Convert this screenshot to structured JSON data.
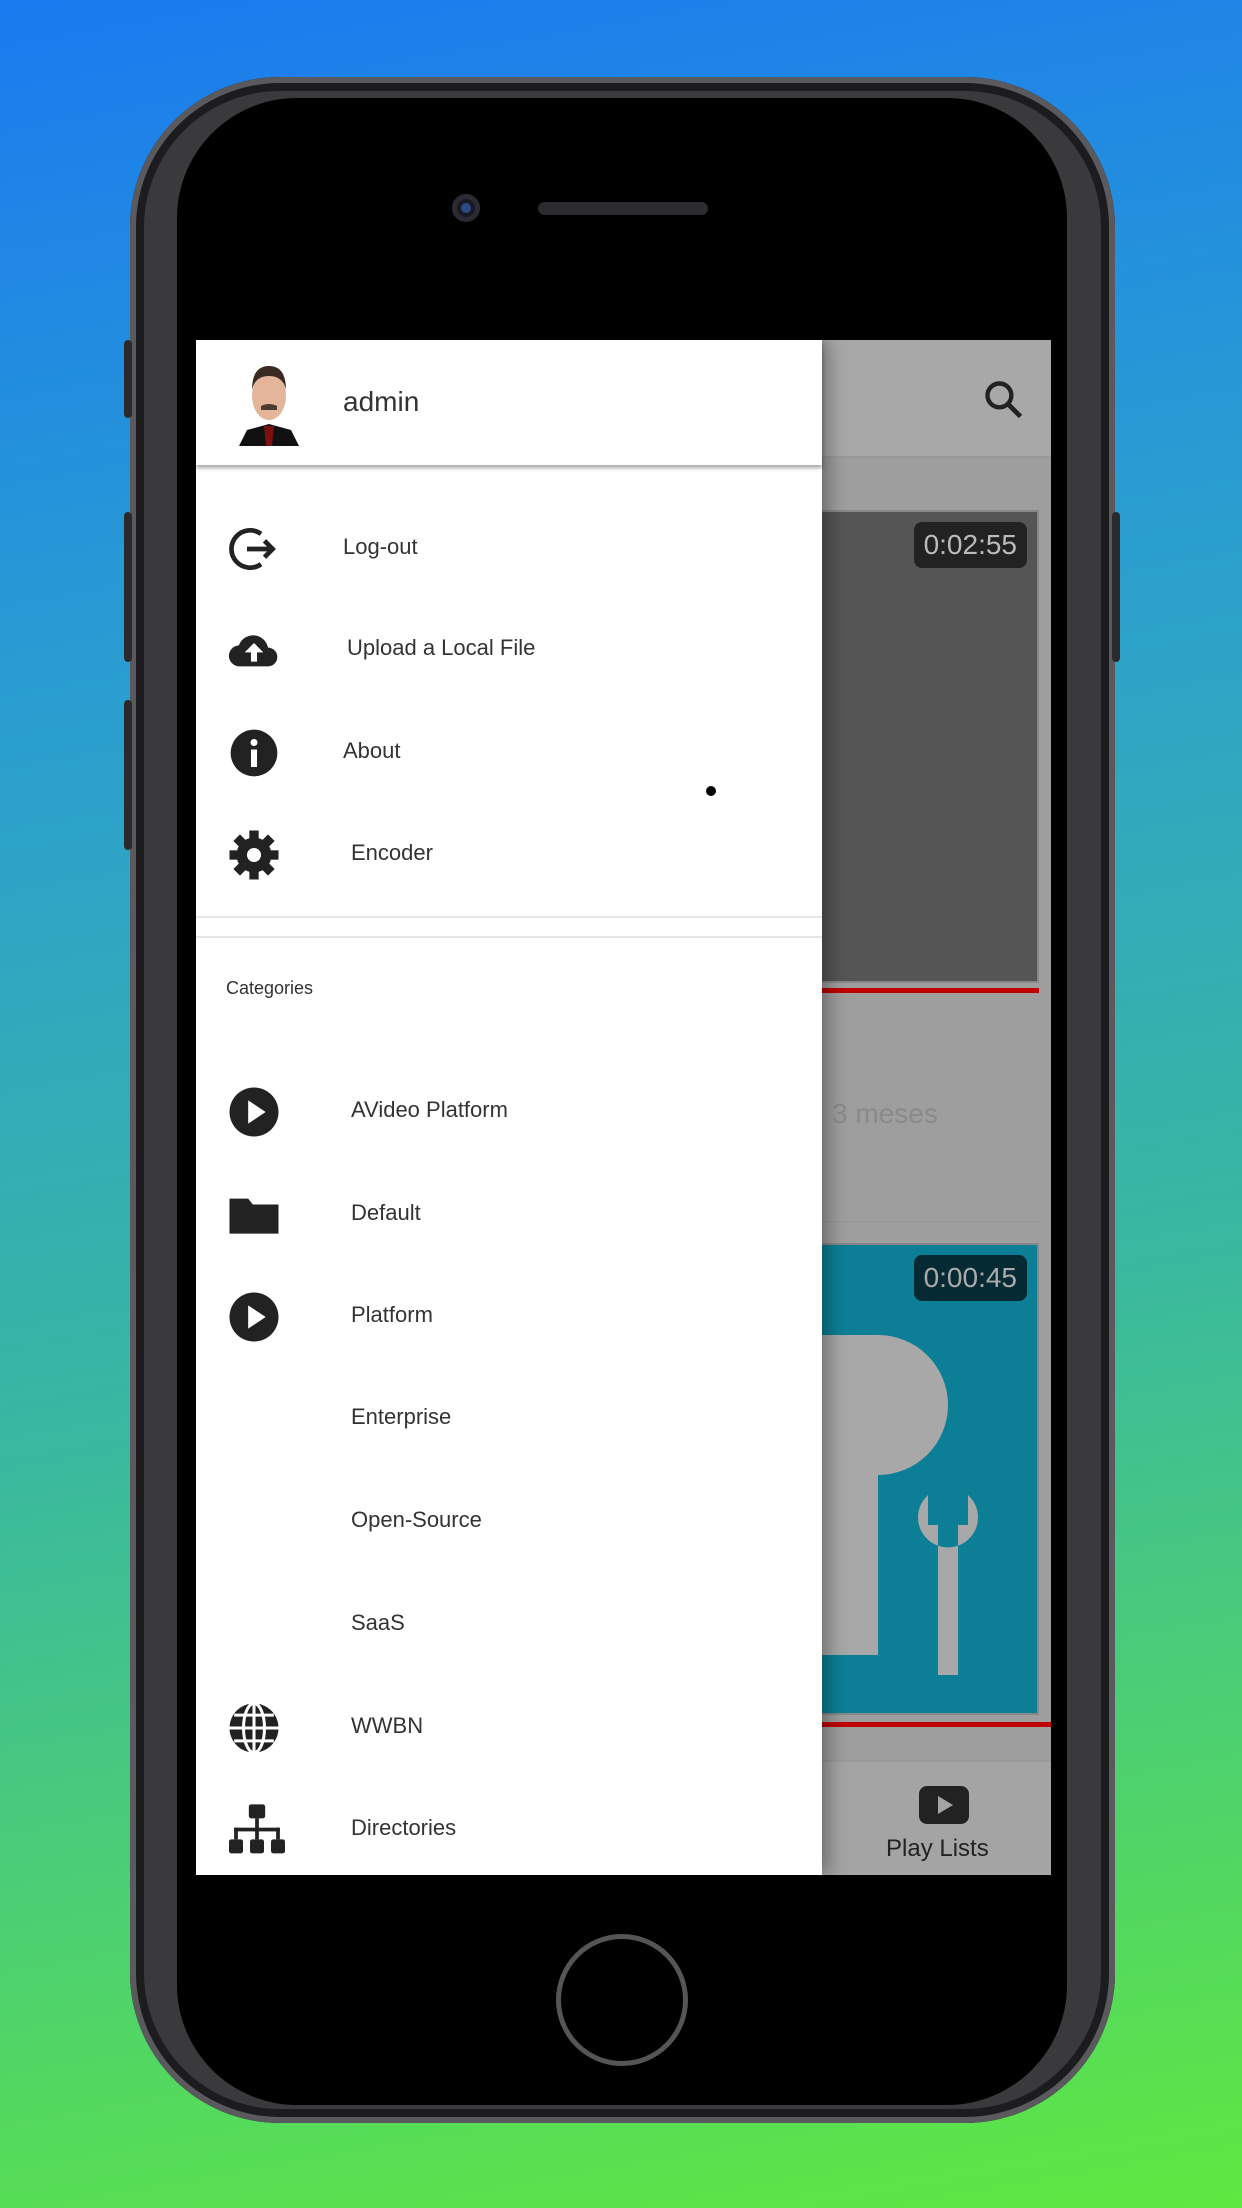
{
  "drawer": {
    "username": "admin",
    "menu": [
      {
        "icon": "logout-icon",
        "label": "Log-out"
      },
      {
        "icon": "cloud-upload-icon",
        "label": "Upload a Local File"
      },
      {
        "icon": "info-icon",
        "label": "About"
      },
      {
        "icon": "gear-icon",
        "label": "Encoder"
      }
    ],
    "categories_heading": "Categories",
    "categories": [
      {
        "icon": "play-circle-icon",
        "label": "AVideo Platform"
      },
      {
        "icon": "folder-icon",
        "label": "Default"
      },
      {
        "icon": "play-circle-icon",
        "label": "Platform"
      },
      {
        "icon": "",
        "label": "Enterprise"
      },
      {
        "icon": "",
        "label": "Open-Source"
      },
      {
        "icon": "",
        "label": "SaaS"
      },
      {
        "icon": "globe-icon",
        "label": "WWBN"
      },
      {
        "icon": "sitemap-icon",
        "label": "Directories"
      }
    ]
  },
  "background_app": {
    "videos": [
      {
        "duration": "0:02:55",
        "meta": "3 meses"
      },
      {
        "duration": "0:00:45"
      }
    ],
    "bottom_nav": {
      "playlists_label": "Play Lists"
    }
  },
  "colors": {
    "accent_red": "#c00000",
    "thumb_teal": "#0c7f96",
    "icon_dark": "#222222"
  }
}
